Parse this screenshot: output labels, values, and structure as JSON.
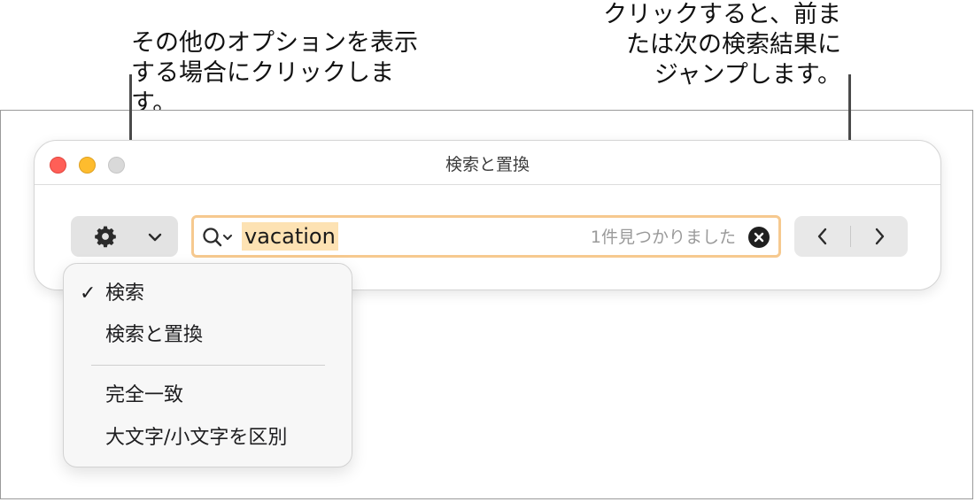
{
  "callouts": {
    "options": "その他のオプションを表示\nする場合にクリックします。",
    "navigate": "クリックすると、前ま\nたは次の検索結果に\nジャンプします。"
  },
  "window": {
    "title": "検索と置換"
  },
  "toolbar": {
    "options_icon": "gear-icon",
    "chevron_icon": "chevron-down-icon"
  },
  "search": {
    "value": "vacation",
    "status": "1件見つかりました",
    "search_icon": "magnifier-with-chevron-icon",
    "clear_icon": "clear-circle-x-icon",
    "highlight_color": "#fde2b3",
    "focus_ring_color": "#f6c98f"
  },
  "navigation": {
    "prev_icon": "chevron-left-icon",
    "next_icon": "chevron-right-icon"
  },
  "menu": {
    "items": [
      {
        "label": "検索",
        "checked": true
      },
      {
        "label": "検索と置換",
        "checked": false
      },
      {
        "label": "完全一致",
        "checked": false
      },
      {
        "label": "大文字/小文字を区別",
        "checked": false
      }
    ],
    "check_mark": "✓"
  },
  "colors": {
    "close": "#ff5f57",
    "minimize": "#febc2e",
    "zoom": "#d9d9d9"
  }
}
